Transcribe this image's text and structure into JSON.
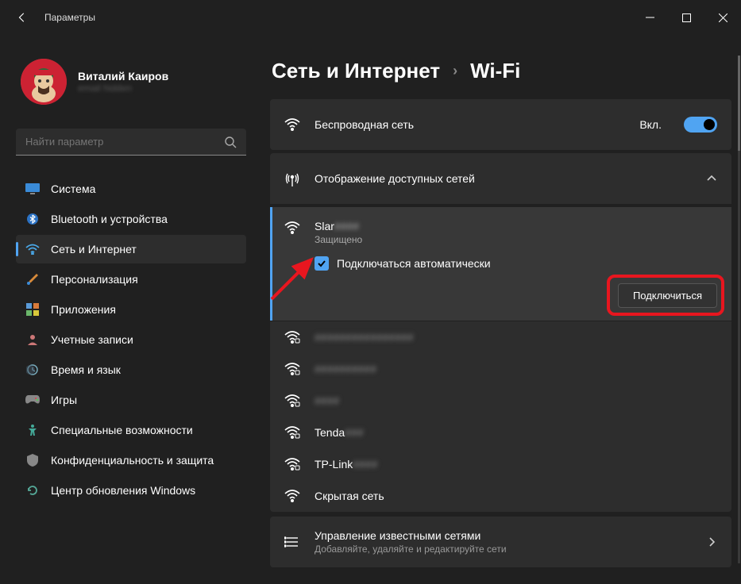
{
  "titlebar": {
    "title": "Параметры"
  },
  "user": {
    "name": "Виталий Каиров",
    "email": "email hidden"
  },
  "search": {
    "placeholder": "Найти параметр"
  },
  "nav": {
    "system": "Система",
    "bluetooth": "Bluetooth и устройства",
    "network": "Сеть и Интернет",
    "personalization": "Персонализация",
    "apps": "Приложения",
    "accounts": "Учетные записи",
    "time": "Время и язык",
    "gaming": "Игры",
    "accessibility": "Специальные возможности",
    "privacy": "Конфиденциальность и защита",
    "update": "Центр обновления Windows"
  },
  "breadcrumb": {
    "parent": "Сеть и Интернет",
    "current": "Wi-Fi"
  },
  "wireless": {
    "label": "Беспроводная сеть",
    "state": "Вкл."
  },
  "available": {
    "label": "Отображение доступных сетей"
  },
  "selected_network": {
    "name": "Slar",
    "name_blur": "####",
    "status": "Защищено",
    "auto_label": "Подключаться автоматически",
    "connect": "Подключиться"
  },
  "networks": [
    {
      "name": "",
      "blur": "################"
    },
    {
      "name": "",
      "blur": "##########"
    },
    {
      "name": "",
      "blur": "####"
    },
    {
      "name": "Tenda",
      "blur": "###"
    },
    {
      "name": "TP-Link",
      "blur": "####"
    },
    {
      "name": "Скрытая сеть",
      "blur": ""
    }
  ],
  "manage": {
    "title": "Управление известными сетями",
    "sub": "Добавляйте, удаляйте и редактируйте сети"
  }
}
